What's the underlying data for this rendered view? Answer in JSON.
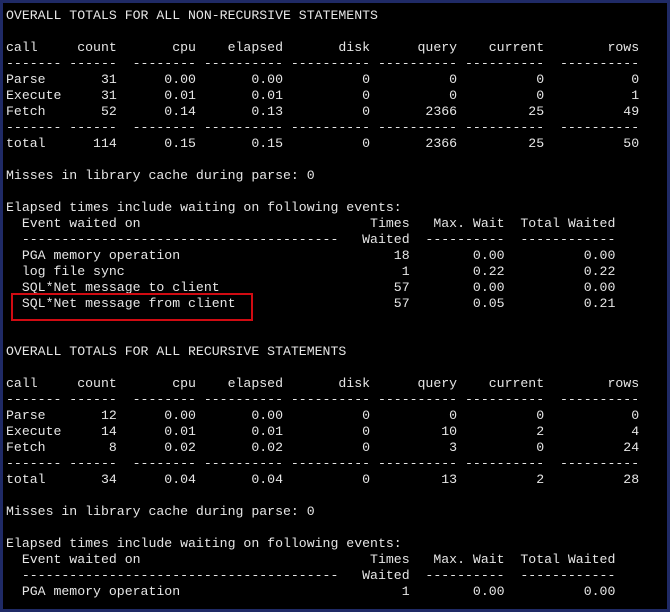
{
  "terminal": {
    "lines": [
      "OVERALL TOTALS FOR ALL NON-RECURSIVE STATEMENTS",
      "",
      "call     count       cpu    elapsed       disk      query    current        rows",
      "------- ------  -------- ---------- ---------- ---------- ----------  ----------",
      "Parse       31      0.00       0.00          0          0          0           0",
      "Execute     31      0.01       0.01          0          0          0           1",
      "Fetch       52      0.14       0.13          0       2366         25          49",
      "------- ------  -------- ---------- ---------- ---------- ----------  ----------",
      "total      114      0.15       0.15          0       2366         25          50",
      "",
      "Misses in library cache during parse: 0",
      "",
      "Elapsed times include waiting on following events:",
      "  Event waited on                             Times   Max. Wait  Total Waited",
      "  ----------------------------------------   Waited  ----------  ------------",
      "  PGA memory operation                           18        0.00          0.00",
      "  log file sync                                   1        0.22          0.22",
      "  SQL*Net message to client                      57        0.00          0.00",
      "  SQL*Net message from client                    57        0.05          0.21",
      "",
      "",
      "OVERALL TOTALS FOR ALL RECURSIVE STATEMENTS",
      "",
      "call     count       cpu    elapsed       disk      query    current        rows",
      "------- ------  -------- ---------- ---------- ---------- ----------  ----------",
      "Parse       12      0.00       0.00          0          0          0           0",
      "Execute     14      0.01       0.01          0         10          2           4",
      "Fetch        8      0.02       0.02          0          3          0          24",
      "------- ------  -------- ---------- ---------- ---------- ----------  ----------",
      "total       34      0.04       0.04          0         13          2          28",
      "",
      "Misses in library cache during parse: 0",
      "",
      "Elapsed times include waiting on following events:",
      "  Event waited on                             Times   Max. Wait  Total Waited",
      "  ----------------------------------------   Waited  ----------  ------------",
      "  PGA memory operation                            1        0.00          0.00"
    ]
  },
  "colors": {
    "background": "#000000",
    "text": "#e6e6e6",
    "highlight_border": "#d10b12",
    "window_border": "#1f2a66"
  }
}
